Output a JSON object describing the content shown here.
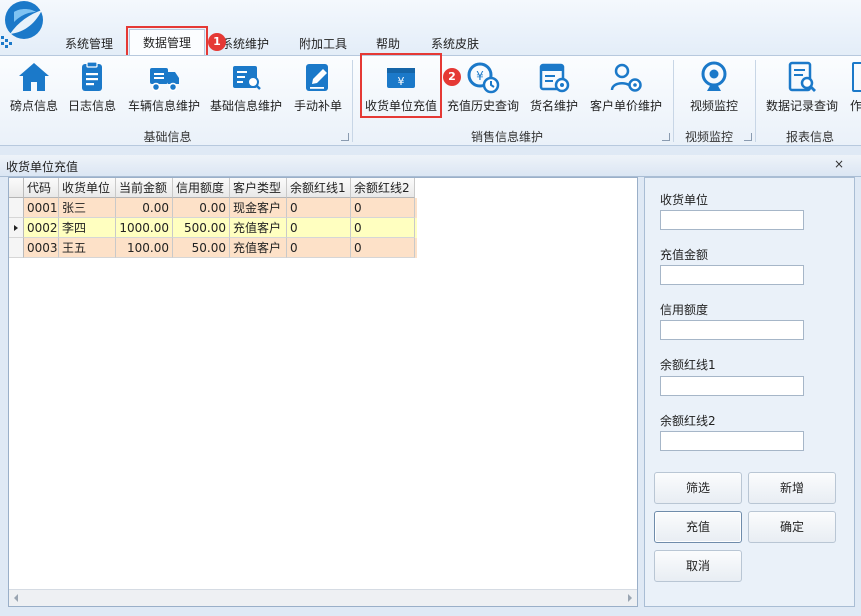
{
  "colors": {
    "accent": "#1b79c9",
    "highlight": "#e53935",
    "row_cash": "#fde1c8",
    "row_selected": "#ffffc0"
  },
  "menu": {
    "tabs": [
      {
        "label": "系统管理"
      },
      {
        "label": "数据管理"
      },
      {
        "label": "系统维护"
      },
      {
        "label": "附加工具"
      },
      {
        "label": "帮助"
      },
      {
        "label": "系统皮肤"
      }
    ],
    "active_tab": "数据管理"
  },
  "callouts": [
    "1",
    "2"
  ],
  "ribbon": {
    "groups": [
      {
        "label": "基础信息"
      },
      {
        "label": "销售信息维护"
      },
      {
        "label": "视频监控"
      },
      {
        "label": "报表信息"
      }
    ],
    "buttons": [
      {
        "label": "磅点信息",
        "icon": "home-icon"
      },
      {
        "label": "日志信息",
        "icon": "clipboard-icon"
      },
      {
        "label": "车辆信息维护",
        "icon": "truck-icon"
      },
      {
        "label": "基础信息维护",
        "icon": "list-search-icon"
      },
      {
        "label": "手动补单",
        "icon": "edit-icon"
      },
      {
        "label": "收货单位充值",
        "icon": "wallet-icon"
      },
      {
        "label": "充值历史查询",
        "icon": "yen-history-icon"
      },
      {
        "label": "货名维护",
        "icon": "card-gear-icon"
      },
      {
        "label": "客户单价维护",
        "icon": "user-gear-icon"
      },
      {
        "label": "视频监控",
        "icon": "webcam-icon"
      },
      {
        "label": "数据记录查询",
        "icon": "search-doc-icon"
      },
      {
        "label": "作",
        "icon": "report-icon"
      }
    ]
  },
  "window": {
    "title": "收货单位充值",
    "close": "×"
  },
  "grid": {
    "columns": [
      "代码",
      "收货单位",
      "当前金额",
      "信用额度",
      "客户类型",
      "余额红线1",
      "余额红线2"
    ],
    "rows": [
      {
        "code": "0001",
        "unit": "张三",
        "amount": "0.00",
        "credit": "0.00",
        "type": "现金客户",
        "red1": "0",
        "red2": "0",
        "selected": false
      },
      {
        "code": "0002",
        "unit": "李四",
        "amount": "1000.00",
        "credit": "500.00",
        "type": "充值客户",
        "red1": "0",
        "red2": "0",
        "selected": true
      },
      {
        "code": "0003",
        "unit": "王五",
        "amount": "100.00",
        "credit": "50.00",
        "type": "充值客户",
        "red1": "0",
        "red2": "0",
        "selected": false
      }
    ]
  },
  "form": {
    "fields": [
      {
        "label": "收货单位",
        "value": ""
      },
      {
        "label": "充值金额",
        "value": ""
      },
      {
        "label": "信用额度",
        "value": ""
      },
      {
        "label": "余额红线1",
        "value": ""
      },
      {
        "label": "余额红线2",
        "value": ""
      }
    ],
    "buttons": {
      "filter": "筛选",
      "add": "新增",
      "recharge": "充值",
      "confirm": "确定",
      "cancel": "取消"
    }
  }
}
